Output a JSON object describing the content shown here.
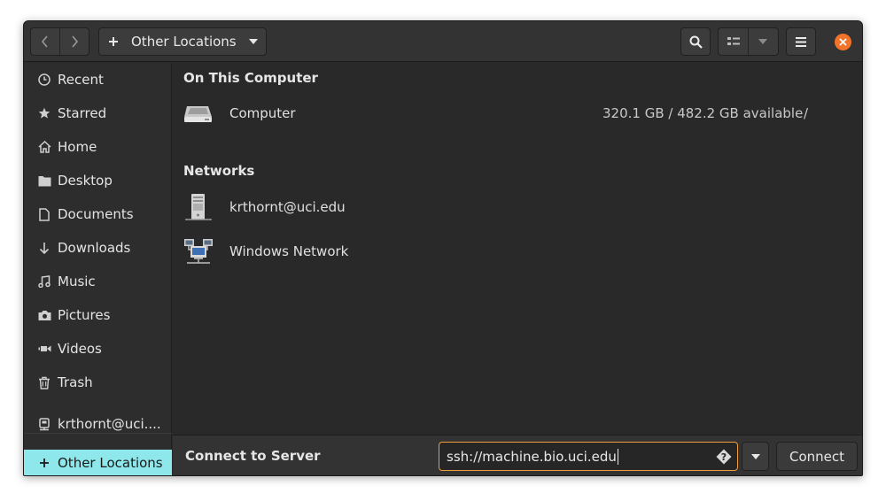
{
  "header": {
    "path_label": "Other Locations",
    "back_icon": "chevron-left-icon",
    "forward_icon": "chevron-right-icon",
    "new_icon": "plus-icon",
    "path_dropdown_icon": "caret-down-icon",
    "search_icon": "search-icon",
    "view_icon": "list-view-icon",
    "view_dropdown_icon": "caret-down-icon",
    "menu_icon": "hamburger-icon",
    "close_icon": "close-icon",
    "close_color": "#f37329"
  },
  "sidebar": {
    "items": [
      {
        "label": "Recent",
        "icon": "clock-icon"
      },
      {
        "label": "Starred",
        "icon": "star-icon"
      },
      {
        "label": "Home",
        "icon": "home-icon"
      },
      {
        "label": "Desktop",
        "icon": "folder-icon"
      },
      {
        "label": "Documents",
        "icon": "document-icon"
      },
      {
        "label": "Downloads",
        "icon": "download-icon"
      },
      {
        "label": "Music",
        "icon": "music-icon"
      },
      {
        "label": "Pictures",
        "icon": "camera-icon"
      },
      {
        "label": "Videos",
        "icon": "video-icon"
      },
      {
        "label": "Trash",
        "icon": "trash-icon"
      },
      {
        "label": "krthornt@uci....",
        "icon": "network-drive-icon"
      }
    ],
    "selected": {
      "label": "Other Locations",
      "icon": "plus-icon",
      "color": "#8ee7ea"
    }
  },
  "main": {
    "on_this_computer": "On This Computer",
    "computer": {
      "label": "Computer",
      "info": "320.1 GB / 482.2 GB available",
      "mount": "/",
      "icon": "harddisk-icon"
    },
    "networks": "Networks",
    "network_items": [
      {
        "label": "krthornt@uci.edu",
        "icon": "server-icon"
      },
      {
        "label": "Windows Network",
        "icon": "network-workgroup-icon"
      }
    ]
  },
  "bottom": {
    "label": "Connect to Server",
    "server_address": "ssh://machine.bio.uci.edu",
    "help_icon": "help-icon",
    "dropdown_icon": "caret-down-icon",
    "connect_label": "Connect",
    "focus_color": "#f39c3c"
  }
}
